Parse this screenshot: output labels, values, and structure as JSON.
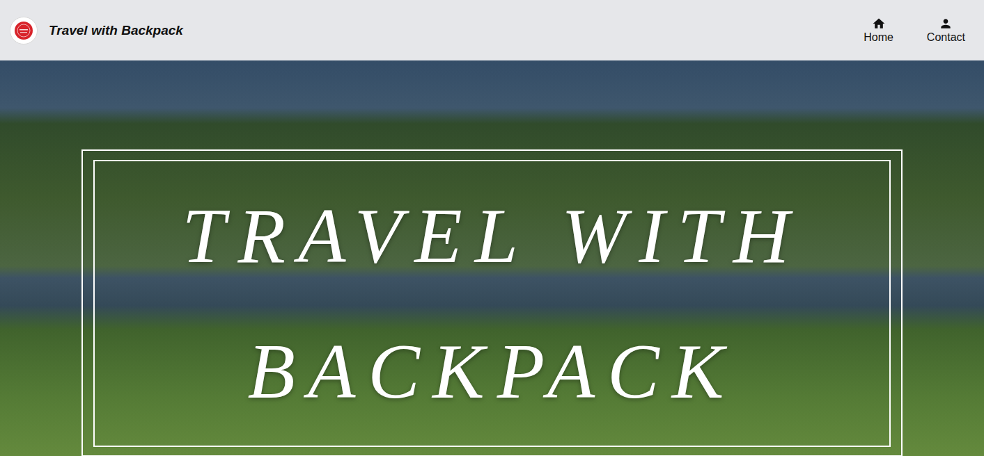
{
  "header": {
    "title": "Travel with Backpack",
    "nav": [
      {
        "label": "Home"
      },
      {
        "label": "Contact"
      }
    ]
  },
  "hero": {
    "title_lines": [
      "TRAVEL WITH",
      "BACKPACK"
    ]
  }
}
